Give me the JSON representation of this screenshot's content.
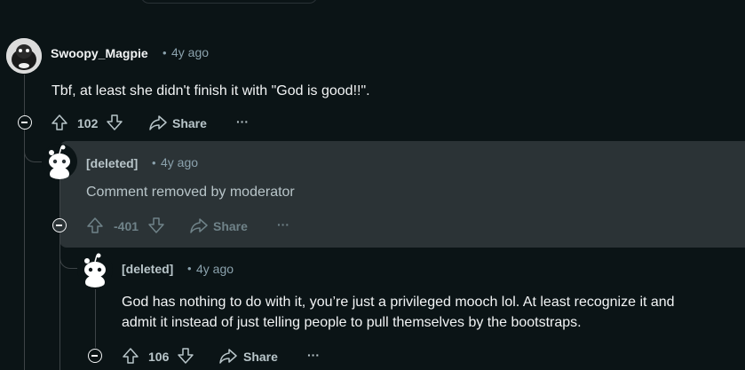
{
  "comments": [
    {
      "username": "Swoopy_Magpie",
      "separator": "•",
      "time": "4y ago",
      "body": "Tbf, at least she didn't finish it with \"God is good!!\".",
      "score": "102",
      "share_label": "Share",
      "more_label": "···"
    },
    {
      "username": "[deleted]",
      "separator": "•",
      "time": "4y ago",
      "body": "Comment removed by moderator",
      "score": "-401",
      "share_label": "Share",
      "more_label": "···"
    },
    {
      "username": "[deleted]",
      "separator": "•",
      "time": "4y ago",
      "body_lines": [
        "God has nothing to do with it, you’re just a privileged mooch lol. At least recognize it and",
        "admit it instead of just telling people to pull themselves by the bootstraps."
      ],
      "score": "106",
      "share_label": "Share",
      "more_label": "···"
    }
  ],
  "colors": {
    "background": "#0b1416",
    "highlight": "#2b3336",
    "text": "#f2f4f5",
    "muted": "#8ba2ad",
    "thread_line": "#3e4447"
  }
}
